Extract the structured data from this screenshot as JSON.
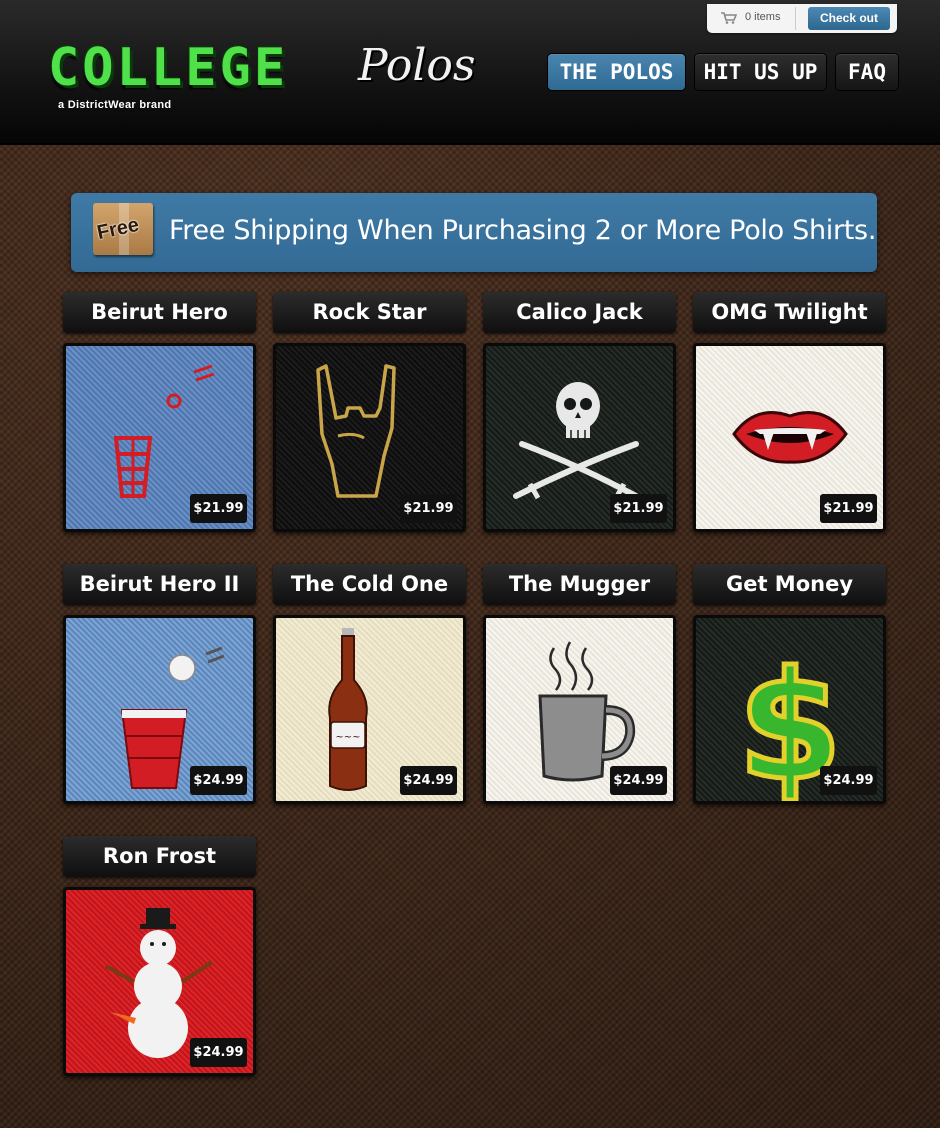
{
  "brand": {
    "logo_main": "COLLEGE",
    "logo_script": "Polos",
    "tagline": "a DistrictWear brand"
  },
  "cart": {
    "count_label": "0 items",
    "checkout_label": "Check out",
    "icon": "cart-icon"
  },
  "nav": {
    "items": [
      {
        "label": "THE POLOS",
        "active": true
      },
      {
        "label": "HIT US UP",
        "active": false
      },
      {
        "label": "FAQ",
        "active": false
      }
    ]
  },
  "banner": {
    "badge": "Free",
    "text": "Free Shipping When Purchasing 2 or More Polo Shirts."
  },
  "products": [
    {
      "name": "Beirut Hero",
      "price": "$21.99",
      "icon": "beer-pong-cup-icon"
    },
    {
      "name": "Rock Star",
      "price": "$21.99",
      "icon": "rock-hand-icon"
    },
    {
      "name": "Calico Jack",
      "price": "$21.99",
      "icon": "jolly-roger-icon"
    },
    {
      "name": "OMG Twilight",
      "price": "$21.99",
      "icon": "vampire-mouth-icon"
    },
    {
      "name": "Beirut Hero II",
      "price": "$24.99",
      "icon": "red-cup-ball-icon"
    },
    {
      "name": "The Cold One",
      "price": "$24.99",
      "icon": "beer-bottle-icon"
    },
    {
      "name": "The Mugger",
      "price": "$24.99",
      "icon": "coffee-mug-icon"
    },
    {
      "name": "Get Money",
      "price": "$24.99",
      "icon": "dollar-sign-icon"
    },
    {
      "name": "Ron Frost",
      "price": "$24.99",
      "icon": "snowman-icon"
    }
  ],
  "colors": {
    "accent_blue": "#3a76a2",
    "logo_green": "#4fe04a",
    "background_brown": "#3a2417"
  }
}
